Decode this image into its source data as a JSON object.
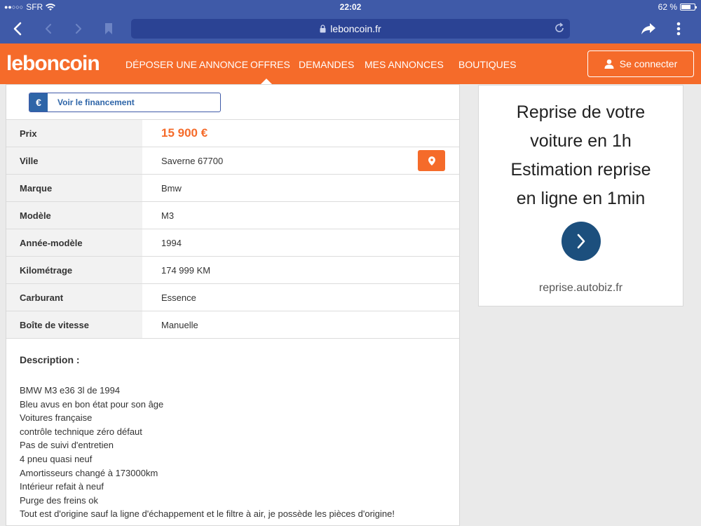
{
  "status_bar": {
    "carrier": "SFR",
    "time": "22:02",
    "battery": "62 %",
    "battery_level": 0.62
  },
  "browser": {
    "url": "leboncoin.fr",
    "icons": [
      "back-icon",
      "forward-icon",
      "bookmark-icon",
      "lock-icon",
      "reload-icon",
      "share-icon",
      "more-icon"
    ]
  },
  "site": {
    "logo": "leboncoin",
    "brand_color": "#f56b2a",
    "nav": [
      {
        "label": "DÉPOSER UNE ANNONCE"
      },
      {
        "label": "OFFRES"
      },
      {
        "label": "DEMANDES"
      },
      {
        "label": "MES ANNONCES"
      },
      {
        "label": "BOUTIQUES"
      }
    ],
    "active_nav": "OFFRES",
    "login_label": "Se connecter"
  },
  "listing": {
    "financing_label": "Voir le financement",
    "financing_symbol": "€",
    "specs": [
      {
        "key": "Prix",
        "value": "15 900 €"
      },
      {
        "key": "Ville",
        "value": "Saverne 67700"
      },
      {
        "key": "Marque",
        "value": "Bmw"
      },
      {
        "key": "Modèle",
        "value": "M3"
      },
      {
        "key": "Année-modèle",
        "value": "1994"
      },
      {
        "key": "Kilométrage",
        "value": "174 999 KM"
      },
      {
        "key": "Carburant",
        "value": "Essence"
      },
      {
        "key": "Boîte de vitesse",
        "value": "Manuelle"
      }
    ],
    "description_title": "Description :",
    "description_lines": [
      "BMW M3 e36 3l de 1994",
      "Bleu avus en bon état pour son âge",
      "Voitures française",
      "contrôle technique zéro défaut",
      "Pas de suivi d'entretien",
      "4 pneu quasi neuf",
      "Amortisseurs changé à 173000km",
      "Intérieur refait à neuf",
      "Purge des freins ok",
      "Tout est d'origine sauf la ligne d'échappement et le filtre à air, je possède les pièces d'origine!"
    ]
  },
  "ad": {
    "headline_lines": [
      "Reprise de votre",
      "voiture en 1h",
      "Estimation reprise",
      "en ligne en 1min"
    ],
    "domain": "reprise.autobiz.fr"
  }
}
